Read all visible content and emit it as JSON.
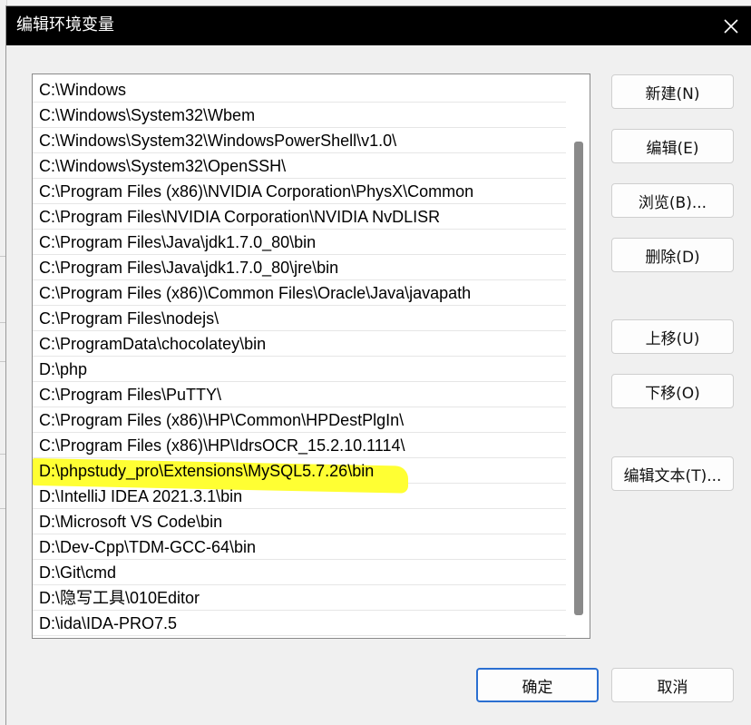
{
  "dialog": {
    "title": "编辑环境变量"
  },
  "path_list": {
    "items": [
      "C:\\Windows",
      "C:\\Windows\\System32\\Wbem",
      "C:\\Windows\\System32\\WindowsPowerShell\\v1.0\\",
      "C:\\Windows\\System32\\OpenSSH\\",
      "C:\\Program Files (x86)\\NVIDIA Corporation\\PhysX\\Common",
      "C:\\Program Files\\NVIDIA Corporation\\NVIDIA NvDLISR",
      "C:\\Program Files\\Java\\jdk1.7.0_80\\bin",
      "C:\\Program Files\\Java\\jdk1.7.0_80\\jre\\bin",
      "C:\\Program Files (x86)\\Common Files\\Oracle\\Java\\javapath",
      "C:\\Program Files\\nodejs\\",
      "C:\\ProgramData\\chocolatey\\bin",
      "D:\\php",
      "C:\\Program Files\\PuTTY\\",
      "C:\\Program Files (x86)\\HP\\Common\\HPDestPlgIn\\",
      "C:\\Program Files (x86)\\HP\\IdrsOCR_15.2.10.1114\\",
      "D:\\phpstudy_pro\\Extensions\\MySQL5.7.26\\bin",
      "D:\\IntelliJ IDEA 2021.3.1\\bin",
      "D:\\Microsoft VS Code\\bin",
      "D:\\Dev-Cpp\\TDM-GCC-64\\bin",
      "D:\\Git\\cmd",
      "D:\\隐写工具\\010Editor",
      "D:\\ida\\IDA-PRO7.5"
    ],
    "highlighted_index": 15,
    "highlight_color": "#ffff33"
  },
  "buttons": {
    "new": "新建(N)",
    "edit": "编辑(E)",
    "browse": "浏览(B)...",
    "delete": "删除(D)",
    "move_up": "上移(U)",
    "move_down": "下移(O)",
    "edit_text": "编辑文本(T)...",
    "ok": "确定",
    "cancel": "取消"
  },
  "colors": {
    "titlebar": "#000000",
    "primary_border": "#2b6fd1"
  }
}
